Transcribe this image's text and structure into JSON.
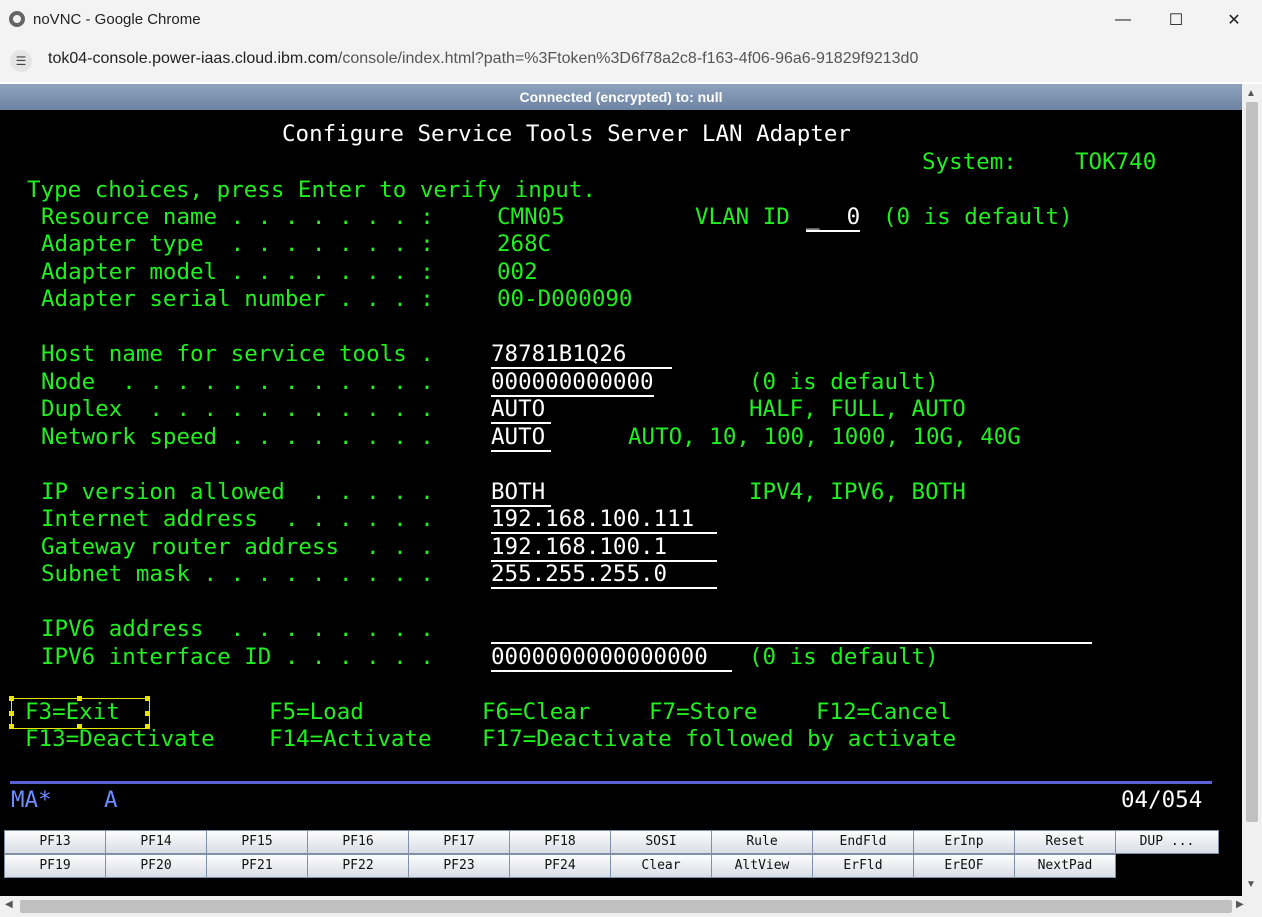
{
  "window": {
    "title": "noVNC - Google Chrome",
    "url_host": "tok04-console.power-iaas.cloud.ibm.com",
    "url_rest": "/console/index.html?path=%3Ftoken%3D6f78a2c8-f163-4f06-96a6-91829f9213d0"
  },
  "novnc": {
    "status": "Connected (encrypted) to: null"
  },
  "terminal": {
    "title": "Configure Service Tools Server LAN Adapter",
    "system_label": "System:",
    "system_value": "TOK740",
    "instruction": "Type choices, press Enter to verify input.",
    "rows": {
      "resource_label": "Resource name . . . . . . . :",
      "resource_value": "CMN05",
      "vlan_label": "VLAN ID",
      "vlan_value": "_  0",
      "vlan_hint": "(0 is default)",
      "adapter_type_label": "Adapter type  . . . . . . . :",
      "adapter_type_value": "268C",
      "adapter_model_label": "Adapter model . . . . . . . :",
      "adapter_model_value": "002",
      "serial_label": "Adapter serial number . . . :",
      "serial_value": "00-D000090",
      "host_label": "Host name for service tools .",
      "host_value": "78781B1Q26",
      "node_label": "Node  . . . . . . . . . . . .",
      "node_value": "000000000000",
      "node_hint": "(0 is default)",
      "duplex_label": "Duplex  . . . . . . . . . . .",
      "duplex_value": "AUTO",
      "duplex_hint": "HALF, FULL, AUTO",
      "speed_label": "Network speed . . . . . . . .",
      "speed_value": "AUTO",
      "speed_hint": "AUTO, 10, 100, 1000, 10G, 40G",
      "ipver_label": "IP version allowed  . . . . .",
      "ipver_value": "BOTH",
      "ipver_hint": "IPV4, IPV6, BOTH",
      "inet_label": "Internet address  . . . . . .",
      "inet_value": "192.168.100.111",
      "gw_label": "Gateway router address  . . .",
      "gw_value": "192.168.100.1",
      "mask_label": "Subnet mask . . . . . . . . .",
      "mask_value": "255.255.255.0",
      "ipv6_label": "IPV6 address  . . . . . . . .",
      "ipv6_value": "",
      "ipv6id_label": "IPV6 interface ID . . . . . .",
      "ipv6id_value": "0000000000000000",
      "ipv6id_hint": "(0 is default)"
    },
    "fkeys": {
      "f3": "F3=Exit",
      "f5": "F5=Load",
      "f6": "F6=Clear",
      "f7": "F7=Store",
      "f12": "F12=Cancel",
      "f13": "F13=Deactivate",
      "f14": "F14=Activate",
      "f17": "F17=Deactivate followed by activate"
    },
    "status": {
      "left1": "MA*",
      "left2": "A",
      "cursor": "04/054"
    }
  },
  "pf_buttons": {
    "row1": [
      "PF13",
      "PF14",
      "PF15",
      "PF16",
      "PF17",
      "PF18",
      "SOSI",
      "Rule",
      "EndFld",
      "ErInp",
      "Reset",
      "DUP ..."
    ],
    "row2": [
      "PF19",
      "PF20",
      "PF21",
      "PF22",
      "PF23",
      "PF24",
      "Clear",
      "AltView",
      "ErFld",
      "ErEOF",
      "NextPad"
    ]
  },
  "colors": {
    "screen_bg": "#000000",
    "text_green": "#22ee22",
    "text_white": "#ffffff",
    "text_blue": "#6c8cff"
  }
}
